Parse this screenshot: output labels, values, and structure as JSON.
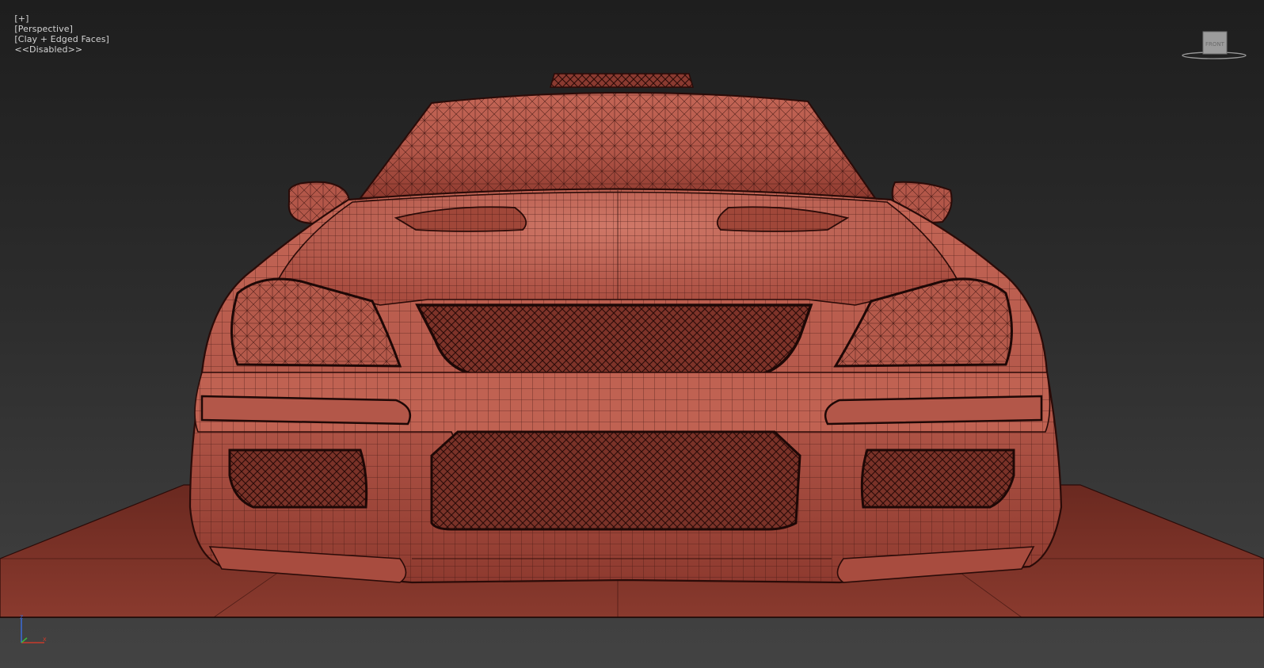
{
  "viewport": {
    "label_plus": "[+]",
    "label_view": "[Perspective]",
    "label_shading": "[Clay + Edged Faces]",
    "label_status": "<<Disabled>>"
  },
  "viewcube": {
    "face_label": "FRONT",
    "icon": "viewcube-icon"
  },
  "axis_tripod": {
    "x": "x",
    "z": "z",
    "icon": "axis-tripod-icon"
  },
  "colors": {
    "clay": "#b85a4c",
    "clay_dark": "#6e2a22",
    "wire": "#3a120e",
    "ground": "#7a3228",
    "background_top": "#1e1e1e",
    "background_bottom": "#434343"
  }
}
